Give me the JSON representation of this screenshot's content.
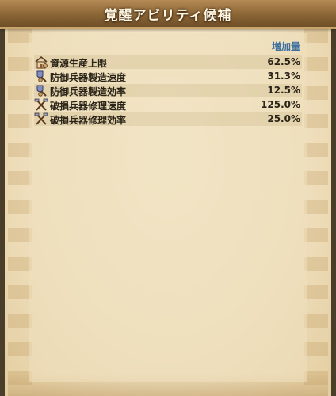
{
  "window": {
    "title": "覚醒アビリティ候補"
  },
  "table": {
    "column_header": "増加量",
    "rows": [
      {
        "label": "資源生産上限",
        "value": "62.5%",
        "icon": "house-icon"
      },
      {
        "label": "防御兵器製造速度",
        "value": "31.3%",
        "icon": "shield-craft-icon"
      },
      {
        "label": "防御兵器製造効率",
        "value": "12.5%",
        "icon": "shield-craft-icon"
      },
      {
        "label": "破損兵器修理速度",
        "value": "125.0%",
        "icon": "crossed-tools-icon"
      },
      {
        "label": "破損兵器修理効率",
        "value": "25.0%",
        "icon": "crossed-tools-icon"
      }
    ]
  },
  "colors": {
    "title_bar": "#8a6535",
    "header_text": "#3a6fa0",
    "row_text": "#2a2418",
    "parchment": "#efdfbd"
  }
}
